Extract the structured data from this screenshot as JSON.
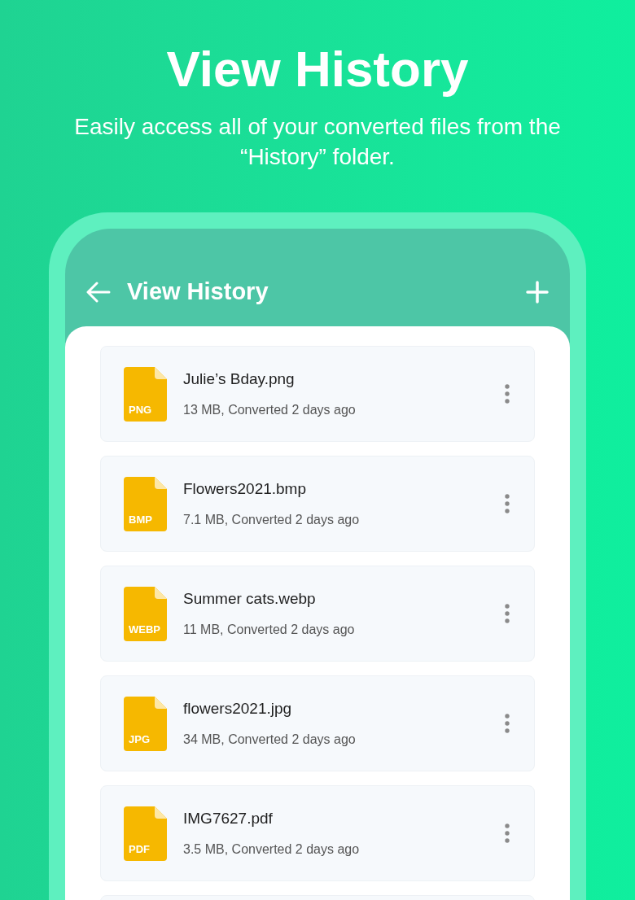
{
  "hero": {
    "title": "View History",
    "subtitle": "Easily access all of your converted files from the “History” folder."
  },
  "app_bar": {
    "title": "View History"
  },
  "files": [
    {
      "type": "PNG",
      "name": "Julie’s Bday.png",
      "meta": "13 MB, Converted 2 days ago"
    },
    {
      "type": "BMP",
      "name": "Flowers2021.bmp",
      "meta": "7.1 MB, Converted 2 days ago"
    },
    {
      "type": "WEBP",
      "name": "Summer cats.webp",
      "meta": "11 MB, Converted 2 days ago"
    },
    {
      "type": "JPG",
      "name": "flowers2021.jpg",
      "meta": "34 MB, Converted 2 days ago"
    },
    {
      "type": "PDF",
      "name": "IMG7627.pdf",
      "meta": "3.5 MB, Converted 2 days ago"
    }
  ]
}
